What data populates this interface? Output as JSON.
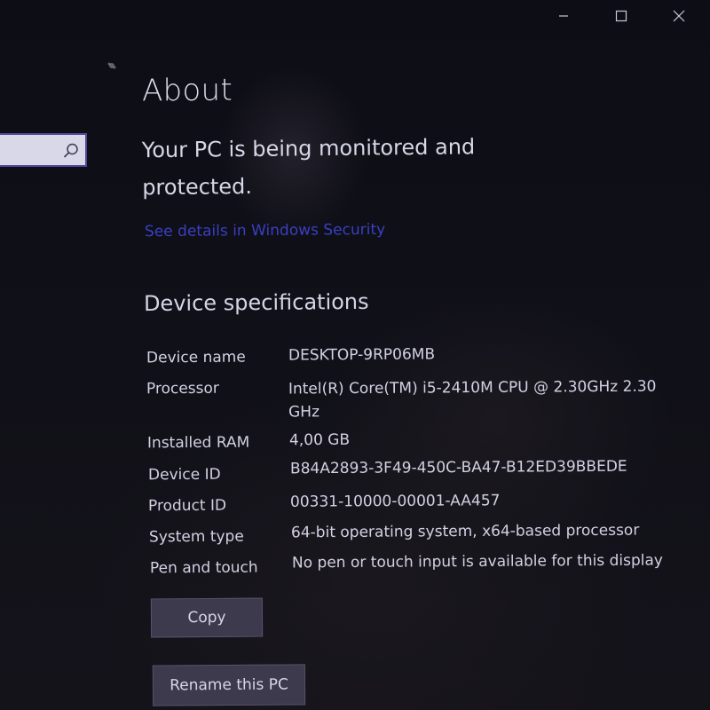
{
  "window": {
    "minimize_icon": "minimize-icon",
    "maximize_icon": "maximize-icon",
    "close_icon": "close-icon"
  },
  "search": {
    "placeholder": "",
    "value": "",
    "icon": "search-icon"
  },
  "page": {
    "title": "About",
    "protection_message": "Your PC is being monitored and protected.",
    "security_link": "See details in Windows Security"
  },
  "specs": {
    "heading": "Device specifications",
    "rows": [
      {
        "label": "Device name",
        "value": "DESKTOP-9RP06MB"
      },
      {
        "label": "Processor",
        "value": "Intel(R) Core(TM) i5-2410M CPU @ 2.30GHz   2.30 GHz"
      },
      {
        "label": "Installed RAM",
        "value": "4,00 GB"
      },
      {
        "label": "Device ID",
        "value": "B84A2893-3F49-450C-BA47-B12ED39BBEDE"
      },
      {
        "label": "Product ID",
        "value": "00331-10000-00001-AA457"
      },
      {
        "label": "System type",
        "value": "64-bit operating system, x64-based processor"
      },
      {
        "label": "Pen and touch",
        "value": "No pen or touch input is available for this display"
      }
    ],
    "copy_label": "Copy"
  },
  "actions": {
    "rename_label": "Rename this PC"
  },
  "colors": {
    "accent": "#3a3fbf",
    "background": "#0d0d16",
    "text": "#d2d1e2",
    "button": "#3d3a4e"
  }
}
